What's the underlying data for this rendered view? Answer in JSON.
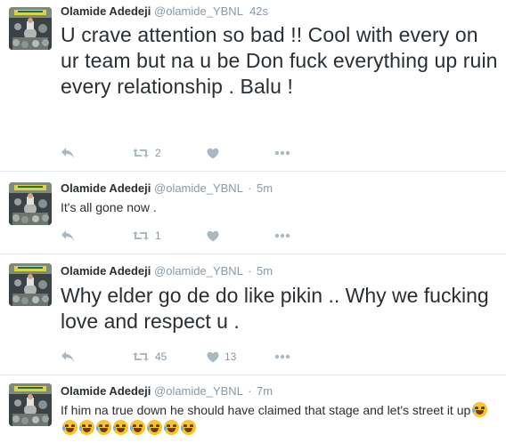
{
  "colors": {
    "name": "#292f33",
    "muted": "#8899a6",
    "icon": "#aab8c2",
    "divider": "#e1e8ed"
  },
  "icons": [
    "reply-icon",
    "retweet-icon",
    "like-icon",
    "more-icon"
  ],
  "tweets": [
    {
      "fullname": "Olamide Adedeji",
      "username": "@olamide_YBNL",
      "dot": "",
      "time": "42s",
      "text": "U crave attention so bad !! Cool with every on ur team but na u be Don fuck everything up ruin every relationship . Balu !",
      "retweets": "2",
      "likes": ""
    },
    {
      "fullname": "Olamide Adedeji",
      "username": "@olamide_YBNL",
      "dot": "·",
      "time": "5m",
      "text": "It's all gone now .",
      "retweets": "1",
      "likes": ""
    },
    {
      "fullname": "Olamide Adedeji",
      "username": "@olamide_YBNL",
      "dot": "·",
      "time": "5m",
      "text": "Why elder go de do like pikin .. Why we fucking love and respect u .",
      "retweets": "45",
      "likes": "13"
    },
    {
      "fullname": "Olamide Adedeji",
      "username": "@olamide_YBNL",
      "dot": "·",
      "time": "7m",
      "text": "If him na true down he should have claimed that stage and let's street it up",
      "emoji_name": "face-with-tears-of-joy",
      "emoji_count": 9,
      "retweets": "",
      "likes": ""
    }
  ]
}
